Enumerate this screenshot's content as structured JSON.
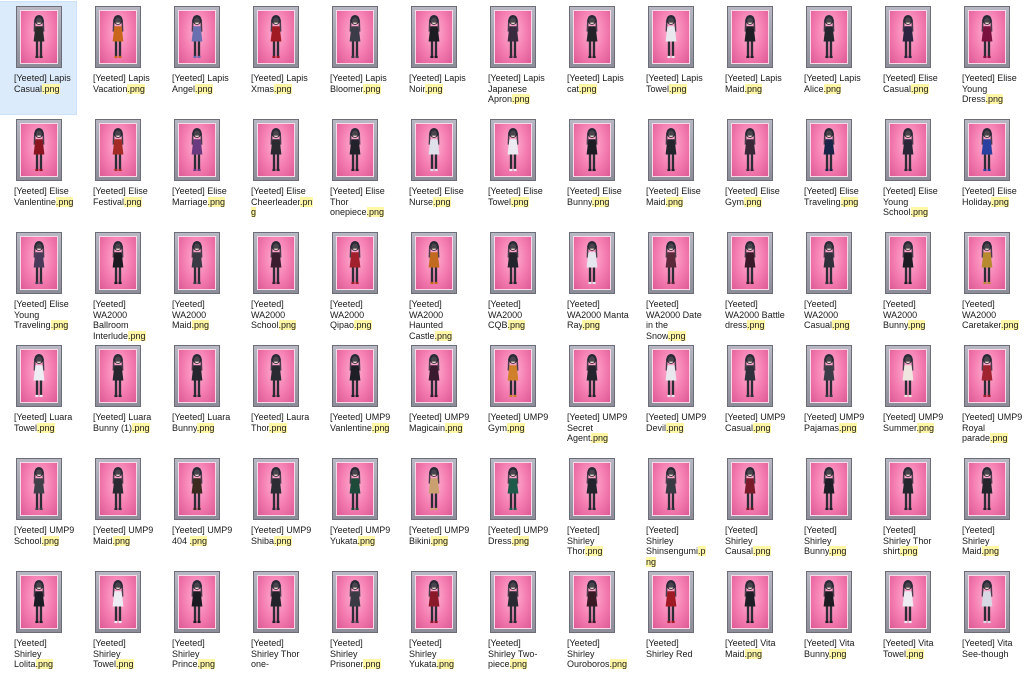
{
  "explorer": {
    "files": [
      {
        "stem": "[Yeeted] Lapis Casual",
        "ext": ".png",
        "selected": true,
        "color": "#2a2a2a"
      },
      {
        "stem": "[Yeeted] Lapis Vacation",
        "ext": ".png",
        "color": "#c8671c"
      },
      {
        "stem": "[Yeeted] Lapis Angel",
        "ext": ".png",
        "color": "#6a6fb0"
      },
      {
        "stem": "[Yeeted] Lapis Xmas",
        "ext": ".png",
        "color": "#a01a24"
      },
      {
        "stem": "[Yeeted] Lapis Bloomer",
        "ext": ".png",
        "color": "#3c3c48"
      },
      {
        "stem": "[Yeeted] Lapis Noir",
        "ext": ".png",
        "color": "#1c1c22"
      },
      {
        "stem": "[Yeeted] Lapis Japanese Apron",
        "ext": ".png",
        "color": "#3a2a40"
      },
      {
        "stem": "[Yeeted] Lapis cat",
        "ext": ".png",
        "color": "#222228"
      },
      {
        "stem": "[Yeeted] Lapis Towel",
        "ext": ".png",
        "color": "#e8e8ee"
      },
      {
        "stem": "[Yeeted] Lapis Maid",
        "ext": ".png",
        "color": "#1e1e24"
      },
      {
        "stem": "[Yeeted] Lapis Alice",
        "ext": ".png",
        "color": "#26262e"
      },
      {
        "stem": "[Yeeted] Elise Casual",
        "ext": ".png",
        "color": "#2c2440"
      },
      {
        "stem": "[Yeeted] Elise Young Dress",
        "ext": ".png",
        "color": "#7a1240"
      },
      {
        "stem": "[Yeeted] Elise Vanlentine",
        "ext": ".png",
        "color": "#8a1420"
      },
      {
        "stem": "[Yeeted] Elise Festival",
        "ext": ".png",
        "color": "#a42a24"
      },
      {
        "stem": "[Yeeted] Elise Marriage",
        "ext": ".png",
        "color": "#6a3a80"
      },
      {
        "stem": "[Yeeted] Elise Cheerleader",
        "ext": ".png",
        "color": "#2a2a30"
      },
      {
        "stem": "[Yeeted] Elise Thor onepiece",
        "ext": ".png",
        "color": "#22222a"
      },
      {
        "stem": "[Yeeted] Elise Nurse",
        "ext": ".png",
        "color": "#e0e0ea"
      },
      {
        "stem": "[Yeeted] Elise Towel",
        "ext": ".png",
        "color": "#ecebf2"
      },
      {
        "stem": "[Yeeted] Elise Bunny",
        "ext": ".png",
        "color": "#1c1c24"
      },
      {
        "stem": "[Yeeted] Elise Maid",
        "ext": ".png",
        "color": "#24242c"
      },
      {
        "stem": "[Yeeted] Elise Gym",
        "ext": ".png",
        "color": "#3a2838"
      },
      {
        "stem": "[Yeeted] Elise Traveling",
        "ext": ".png",
        "color": "#1a2448"
      },
      {
        "stem": "[Yeeted] Elise Young School",
        "ext": ".png",
        "color": "#2a2638"
      },
      {
        "stem": "[Yeeted] Elise Holiday",
        "ext": ".png",
        "color": "#2a40a0"
      },
      {
        "stem": "[Yeeted] Elise Young Traveling",
        "ext": ".png",
        "color": "#4a3a5a"
      },
      {
        "stem": "[Yeeted] WA2000 Ballroom Interlude",
        "ext": ".png",
        "color": "#1a1a20"
      },
      {
        "stem": "[Yeeted] WA2000 Maid",
        "ext": ".png",
        "color": "#3a3a44"
      },
      {
        "stem": "[Yeeted] WA2000 School",
        "ext": ".png",
        "color": "#3a1e30"
      },
      {
        "stem": "[Yeeted] WA2000 Qipao",
        "ext": ".png",
        "color": "#a0202c"
      },
      {
        "stem": "[Yeeted] WA2000 Haunted Castle",
        "ext": ".png",
        "color": "#c26a20"
      },
      {
        "stem": "[Yeeted] WA2000 CQB",
        "ext": ".png",
        "color": "#24242c"
      },
      {
        "stem": "[Yeeted] WA2000 Manta Ray",
        "ext": ".png",
        "color": "#e6e6ee"
      },
      {
        "stem": "[Yeeted] WA2000 Date in the Snow",
        "ext": ".png",
        "color": "#5a2a3a"
      },
      {
        "stem": "[Yeeted] WA2000 Battle dress",
        "ext": ".png",
        "color": "#3a1a28"
      },
      {
        "stem": "[Yeeted] WA2000 Casual",
        "ext": ".png",
        "color": "#30303a"
      },
      {
        "stem": "[Yeeted] WA2000 Bunny",
        "ext": ".png",
        "color": "#1c1c22"
      },
      {
        "stem": "[Yeeted] WA2000 Caretaker",
        "ext": ".png",
        "color": "#b88a30"
      },
      {
        "stem": "[Yeeted] Luara Towel",
        "ext": ".png",
        "color": "#ededf4"
      },
      {
        "stem": "[Yeeted] Luara Bunny (1)",
        "ext": ".png",
        "color": "#26262e"
      },
      {
        "stem": "[Yeeted] Luara Bunny",
        "ext": ".png",
        "color": "#26262e"
      },
      {
        "stem": "[Yeeted] Laura Thor",
        "ext": ".png",
        "color": "#2a2a32"
      },
      {
        "stem": "[Yeeted] UMP9 Vanlentine",
        "ext": ".png",
        "color": "#1e1e26"
      },
      {
        "stem": "[Yeeted] UMP9 Magicain",
        "ext": ".png",
        "color": "#3a1a2e"
      },
      {
        "stem": "[Yeeted] UMP9 Gym",
        "ext": ".png",
        "color": "#d0802a"
      },
      {
        "stem": "[Yeeted] UMP9 Secret Agent",
        "ext": ".png",
        "color": "#24242c"
      },
      {
        "stem": "[Yeeted] UMP9 Devil",
        "ext": ".png",
        "color": "#e8e8ee"
      },
      {
        "stem": "[Yeeted] UMP9 Casual",
        "ext": ".png",
        "color": "#30303c"
      },
      {
        "stem": "[Yeeted] UMP9 Pajamas",
        "ext": ".png",
        "color": "#3c3c48"
      },
      {
        "stem": "[Yeeted] UMP9 Summer",
        "ext": ".png",
        "color": "#f0e6e0"
      },
      {
        "stem": "[Yeeted] UMP9 Royal parade",
        "ext": ".png",
        "color": "#a02430"
      },
      {
        "stem": "[Yeeted] UMP9 School",
        "ext": ".png",
        "color": "#404048"
      },
      {
        "stem": "[Yeeted] UMP9 Maid",
        "ext": ".png",
        "color": "#2a2a32"
      },
      {
        "stem": "[Yeeted] UMP9 404 ",
        "ext": ".png",
        "color": "#3a2a20"
      },
      {
        "stem": "[Yeeted] UMP9 Shiba",
        "ext": ".png",
        "color": "#2c2c34"
      },
      {
        "stem": "[Yeeted] UMP9 Yukata",
        "ext": ".png",
        "color": "#1e4a3a"
      },
      {
        "stem": "[Yeeted] UMP9 Bikini",
        "ext": ".png",
        "color": "#caa070"
      },
      {
        "stem": "[Yeeted] UMP9 Dress",
        "ext": ".png",
        "color": "#1e5a4a"
      },
      {
        "stem": "[Yeeted] Shirley Thor",
        "ext": ".png",
        "color": "#24242c"
      },
      {
        "stem": "[Yeeted] Shirley Shinsengumi",
        "ext": ".png",
        "color": "#3a3a44"
      },
      {
        "stem": "[Yeeted] Shirley Causal",
        "ext": ".png",
        "color": "#7a1a2a"
      },
      {
        "stem": "[Yeeted] Shirley Bunny",
        "ext": ".png",
        "color": "#1e1e26"
      },
      {
        "stem": "[Yeeted] Shirley Thor shirt",
        "ext": ".png",
        "color": "#26262e"
      },
      {
        "stem": "[Yeeted] Shirley Maid",
        "ext": ".png",
        "color": "#24242c"
      },
      {
        "stem": "[Yeeted] Shirley Lolita",
        "ext": ".png",
        "color": "#1c1c24"
      },
      {
        "stem": "[Yeeted] Shirley Towel",
        "ext": ".png",
        "color": "#ececf2"
      },
      {
        "stem": "[Yeeted] Shirley Prince",
        "ext": ".png",
        "color": "#1a1a20"
      },
      {
        "stem": "[Yeeted] Shirley Thor one-",
        "ext": "",
        "color": "#22222a"
      },
      {
        "stem": "[Yeeted] Shirley Prisoner",
        "ext": ".png",
        "color": "#3a3a44"
      },
      {
        "stem": "[Yeeted] Shirley Yukata",
        "ext": ".png",
        "color": "#8a1a2a"
      },
      {
        "stem": "[Yeeted] Shirley Two-piece",
        "ext": ".png",
        "color": "#2a2a32"
      },
      {
        "stem": "[Yeeted] Shirley Ouroboros",
        "ext": ".png",
        "color": "#3a1a24"
      },
      {
        "stem": "[Yeeted] Shirley Red",
        "ext": "",
        "color": "#a01a24"
      },
      {
        "stem": "[Yeeted] Vita Maid",
        "ext": ".png",
        "color": "#1e1e26"
      },
      {
        "stem": "[Yeeted] Vita Bunny",
        "ext": ".png",
        "color": "#1c1c22"
      },
      {
        "stem": "[Yeeted] Vita Towel",
        "ext": ".png",
        "color": "#ececf2"
      },
      {
        "stem": "[Yeeted] Vita See-though",
        "ext": "",
        "color": "#d8d8e4"
      }
    ]
  }
}
